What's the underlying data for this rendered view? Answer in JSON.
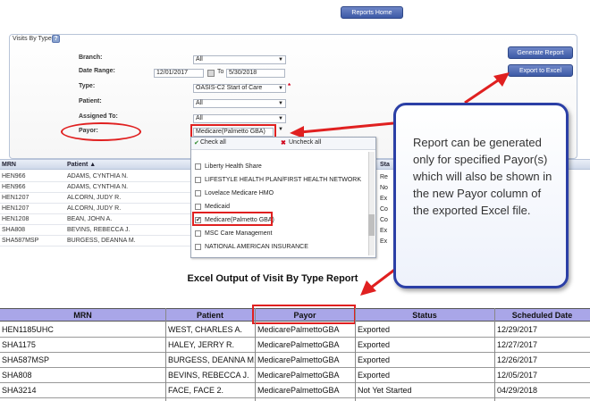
{
  "toolbar": {
    "reports_home": "Reports Home"
  },
  "panel": {
    "title": "Visits By Type",
    "help": "?",
    "generate_label": "Generate Report",
    "export_label": "Export to Excel"
  },
  "form": {
    "branch_label": "Branch:",
    "branch_value": "All",
    "date_label": "Date Range:",
    "date_from": "12/01/2017",
    "date_to_label": "To",
    "date_to": "5/30/2018",
    "type_label": "Type:",
    "type_value": "OASIS-C2 Start of Care",
    "required_mark": "*",
    "patient_label": "Patient:",
    "patient_value": "All",
    "assigned_label": "Assigned To:",
    "assigned_value": "All",
    "payor_label": "Payor:",
    "payor_value": "Medicare(Palmetto GBA)"
  },
  "dropdown": {
    "check_all": "Check all",
    "uncheck_all": "Uncheck all",
    "items": [
      {
        "label": "Liberty Health Share",
        "checked": false
      },
      {
        "label": "LIFESTYLE HEALTH PLAN/FIRST HEALTH NETWORK",
        "checked": false
      },
      {
        "label": "Lovelace Medicare HMO",
        "checked": false
      },
      {
        "label": "Medicaid",
        "checked": false
      },
      {
        "label": "Medicare(Palmetto GBA)",
        "checked": true
      },
      {
        "label": "MSC Care Management",
        "checked": false
      },
      {
        "label": "NATIONAL AMERICAN INSURANCE",
        "checked": false
      }
    ]
  },
  "grid": {
    "headers": [
      "MRN",
      "Patient ▲",
      "Sta"
    ],
    "rows": [
      [
        "HEN966",
        "ADAMS, CYNTHIA N.",
        "Re"
      ],
      [
        "HEN966",
        "ADAMS, CYNTHIA N.",
        "No"
      ],
      [
        "HEN1207",
        "ALCORN, JUDY R.",
        "Ex"
      ],
      [
        "HEN1207",
        "ALCORN, JUDY R.",
        "Co"
      ],
      [
        "HEN1208",
        "BEAN, JOHN A.",
        "Co"
      ],
      [
        "SHA808",
        "BEVINS, REBECCA J.",
        "Ex"
      ],
      [
        "SHA587MSP",
        "BURGESS, DEANNA M.",
        "Ex"
      ]
    ]
  },
  "callout": {
    "text": "Report can be generated only for specified Payor(s) which will also be shown in the new Payor column of the exported Excel file."
  },
  "excel": {
    "title": "Excel Output of Visit By Type Report",
    "headers": [
      "MRN",
      "Patient",
      "Payor",
      "Status",
      "Scheduled Date"
    ],
    "rows": [
      [
        "HEN1185UHC",
        "WEST, CHARLES A.",
        "MedicarePalmettoGBA",
        "Exported",
        "12/29/2017"
      ],
      [
        "SHA1175",
        "HALEY, JERRY R.",
        "MedicarePalmettoGBA",
        "Exported",
        "12/27/2017"
      ],
      [
        "SHA587MSP",
        "BURGESS, DEANNA M.",
        "MedicarePalmettoGBA",
        "Exported",
        "12/26/2017"
      ],
      [
        "SHA808",
        "BEVINS, REBECCA J.",
        "MedicarePalmettoGBA",
        "Exported",
        "12/05/2017"
      ],
      [
        "SHA3214",
        "FACE, FACE 2.",
        "MedicarePalmettoGBA",
        "Not Yet Started",
        "04/29/2018"
      ]
    ]
  },
  "colors": {
    "highlight": "#e02020",
    "callout_border": "#2b3fa6",
    "excel_header": "#a9a6e8"
  }
}
